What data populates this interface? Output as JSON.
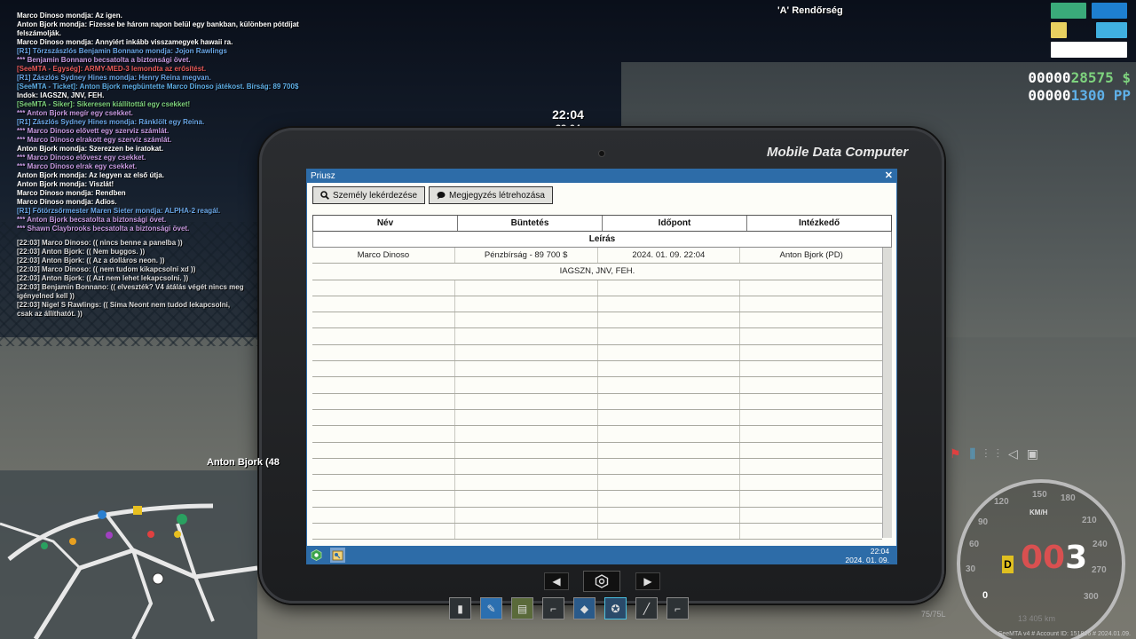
{
  "chat": [
    {
      "text": "Marco Dinoso mondja: Az igen.",
      "color": "#ffffff"
    },
    {
      "text": "Anton Bjork mondja: Fizesse be három napon belül egy bankban, különben pótdíjat",
      "color": "#ffffff"
    },
    {
      "text": " felszámolják.",
      "color": "#ffffff"
    },
    {
      "text": "Marco Dinoso mondja: Annyiért inkább visszamegyek hawaii ra.",
      "color": "#ffffff"
    },
    {
      "text": "[R1] Törzszászlós Benjamin Bonnano mondja: Jojon Rawlings",
      "color": "#6aa7e8"
    },
    {
      "text": "*** Benjamin Bonnano becsatolta a biztonsági övet.",
      "color": "#c79ae0"
    },
    {
      "text": "[SeeMTA - Egység]: ARMY-MED-3 lemondta az erősítést.",
      "color": "#e85a5a"
    },
    {
      "text": "[R1] Zászlós Sydney Hines mondja: Henry Reina megvan.",
      "color": "#6aa7e8"
    },
    {
      "text": "[SeeMTA - Ticket]: Anton Bjork megbüntette Marco Dinoso játékost. Bírság: 89 700$",
      "color": "#5fb0e8"
    },
    {
      "text": " Indok: IAGSZN, JNV, FEH.",
      "color": "#ffffff"
    },
    {
      "text": "[SeeMTA - Siker]: Sikeresen kiállítottál egy csekket!",
      "color": "#7ed37e"
    },
    {
      "text": "*** Anton Bjork megír egy csekket.",
      "color": "#c79ae0"
    },
    {
      "text": "[R1] Zászlós Sydney Hines mondja: Ránklölt egy Reina.",
      "color": "#6aa7e8"
    },
    {
      "text": "*** Marco Dinoso elővett egy szerviz számlát.",
      "color": "#c79ae0"
    },
    {
      "text": "*** Marco Dinoso elrakott egy szerviz számlát.",
      "color": "#c79ae0"
    },
    {
      "text": "Anton Bjork mondja: Szerezzen be iratokat.",
      "color": "#ffffff"
    },
    {
      "text": "*** Marco Dinoso elővesz egy csekket.",
      "color": "#c79ae0"
    },
    {
      "text": "*** Marco Dinoso elrak egy csekket.",
      "color": "#c79ae0"
    },
    {
      "text": "Anton Bjork mondja: Az legyen az első útja.",
      "color": "#ffffff"
    },
    {
      "text": "Anton Bjork mondja: Viszlát!",
      "color": "#ffffff"
    },
    {
      "text": "Marco Dinoso mondja: Rendben",
      "color": "#ffffff"
    },
    {
      "text": "Marco Dinoso mondja: Adios.",
      "color": "#ffffff"
    },
    {
      "text": "[R1] Főtörzsőrmester Maren Sieter mondja: ALPHA-2 reagál.",
      "color": "#6aa7e8"
    },
    {
      "text": "*** Anton Bjork becsatolta a biztonsági övet.",
      "color": "#c79ae0"
    },
    {
      "text": "*** Shawn Claybrooks becsatolta a biztonsági övet.",
      "color": "#c79ae0"
    },
    {
      "text": "",
      "color": "#ffffff"
    },
    {
      "text": "[22:03] Marco Dinoso: (( nincs benne a panelba ))",
      "color": "#dddddd"
    },
    {
      "text": "[22:03] Anton Bjork: (( Nem buggos. ))",
      "color": "#dddddd"
    },
    {
      "text": "[22:03] Anton Bjork: (( Az a dolláros neon. ))",
      "color": "#dddddd"
    },
    {
      "text": "[22:03] Marco Dinoso: (( nem tudom kikapcsolni xd ))",
      "color": "#dddddd"
    },
    {
      "text": "[22:03] Anton Bjork: (( Azt nem lehet lekapcsolni. ))",
      "color": "#dddddd"
    },
    {
      "text": "[22:03] Benjamin Bonnano: (( elveszték? V4 átálás végét nincs meg",
      "color": "#dddddd"
    },
    {
      "text": " igényelned kell ))",
      "color": "#dddddd"
    },
    {
      "text": "[22:03] Nigel S Rawlings: (( Sima Neont nem tudod lekapcsolni,",
      "color": "#dddddd"
    },
    {
      "text": " csak az állíthatót. ))",
      "color": "#dddddd"
    }
  ],
  "radio": "'A' Rendőrség",
  "clock": {
    "big": "22:04",
    "small": "22:04"
  },
  "hud": {
    "money_zeros": "00000",
    "money_value": "28575 $",
    "pp_zeros": "00000",
    "pp_value": "1300 PP",
    "colors": {
      "green": "#3aaa7a",
      "blue": "#1e7fd0",
      "yellow": "#e8d060",
      "cyan": "#40b0e0",
      "white": "#ffffff"
    }
  },
  "tablet": {
    "title": "Mobile Data Computer",
    "window": {
      "title": "Priusz",
      "close": "✕",
      "buttons": [
        {
          "icon": "search-icon",
          "label": "Személy lekérdezése"
        },
        {
          "icon": "comment-icon",
          "label": "Megjegyzés létrehozása"
        }
      ],
      "columns": [
        "Név",
        "Büntetés",
        "Időpont",
        "Intézkedő"
      ],
      "subheader": "Leírás",
      "rows": [
        {
          "name": "Marco Dinoso",
          "penalty": "Pénzbírság - 89 700 $",
          "time": "2024. 01. 09. 22:04",
          "officer": "Anton Bjork (PD)",
          "description": "IAGSZN, JNV, FEH."
        }
      ]
    },
    "taskbar": {
      "time": "22:04",
      "date": "2024. 01. 09."
    }
  },
  "player_name": "Anton Bjork (48",
  "speedo": {
    "speed_dim": "00",
    "speed": "3",
    "gear": "D",
    "unit": "KM/H",
    "fuel": "75/75L",
    "odometer": "13 405 km",
    "ticks": [
      "30",
      "60",
      "90",
      "120",
      "150",
      "180",
      "210",
      "240",
      "270",
      "300"
    ],
    "zero": "0"
  },
  "footer": "SeeMTA v4 # Account ID: 151826 # 2024.01.09."
}
